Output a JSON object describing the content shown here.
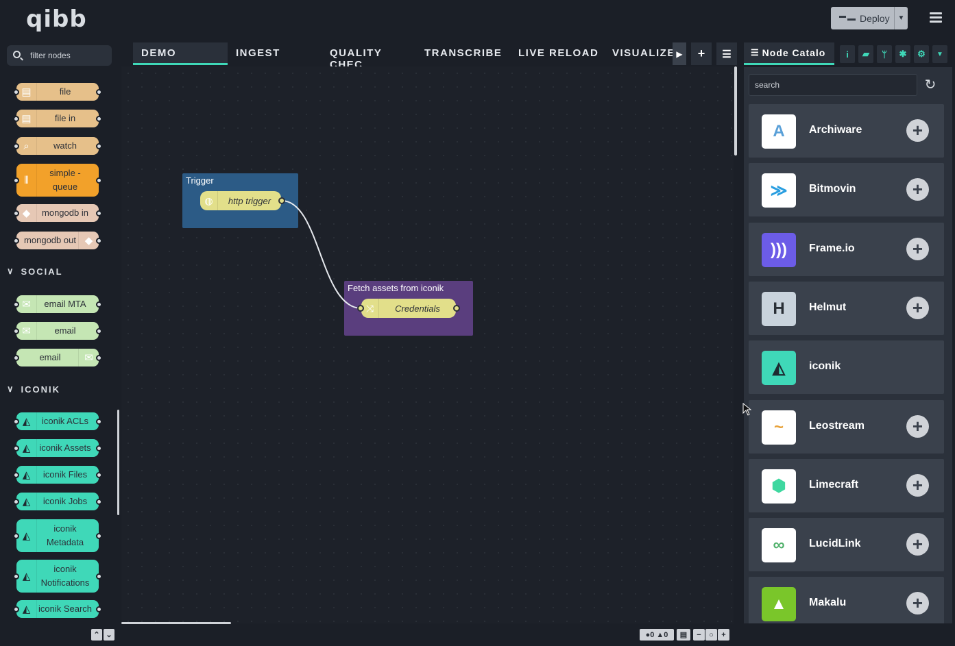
{
  "app": {
    "logo": "qibb"
  },
  "header": {
    "deploy_label": "Deploy",
    "menu_icon": "hamburger-icon"
  },
  "palette": {
    "filter_placeholder": "filter nodes",
    "storage_nodes": [
      {
        "label": "file",
        "color": "#e6c08a",
        "icon": "file-icon"
      },
      {
        "label": "file in",
        "color": "#e6c08a",
        "icon": "file-icon"
      },
      {
        "label": "watch",
        "color": "#e6c08a",
        "icon": "watch-icon"
      },
      {
        "label": "simple -\nqueue",
        "color": "#f2a12a",
        "icon": "queue-icon"
      },
      {
        "label": "mongodb in",
        "color": "#e6c8b5",
        "icon": "mongodb-icon"
      },
      {
        "label": "mongodb out",
        "color": "#e6c8b5",
        "icon": "mongodb-icon"
      }
    ],
    "social_header": "SOCIAL",
    "social_nodes": [
      {
        "label": "email MTA",
        "color": "#c5e6b4",
        "icon": "envelope-icon"
      },
      {
        "label": "email",
        "color": "#c5e6b4",
        "icon": "envelope-icon"
      },
      {
        "label": "email",
        "color": "#c5e6b4",
        "icon": "envelope-icon"
      }
    ],
    "iconik_header": "ICONIK",
    "iconik_nodes": [
      {
        "label": "iconik ACLs",
        "color": "#3fd8b8"
      },
      {
        "label": "iconik Assets",
        "color": "#3fd8b8"
      },
      {
        "label": "iconik Files",
        "color": "#3fd8b8"
      },
      {
        "label": "iconik Jobs",
        "color": "#3fd8b8"
      },
      {
        "label": "iconik\nMetadata",
        "color": "#3fd8b8"
      },
      {
        "label": "iconik\nNotifications",
        "color": "#3fd8b8"
      },
      {
        "label": "iconik Search",
        "color": "#3fd8b8"
      }
    ]
  },
  "tabs": [
    "DEMO",
    "INGEST",
    "QUALITY CHEC",
    "TRANSCRIBE",
    "LIVE RELOAD",
    "VISUALIZE"
  ],
  "flow": {
    "groups": [
      {
        "label": "Trigger",
        "color": "#2c5b86"
      },
      {
        "label": "Fetch assets from iconik",
        "color": "#5a3e7e"
      }
    ],
    "nodes": [
      {
        "label": "http trigger",
        "icon": "globe-icon"
      },
      {
        "label": "Credentials",
        "icon": "shuffle-icon"
      }
    ]
  },
  "footer": {
    "errors": "0",
    "warnings": "0"
  },
  "sidebar": {
    "tab_label": "Node Catalo",
    "search_placeholder": "search",
    "catalog": [
      {
        "name": "Archiware",
        "logo_bg": "#ffffff",
        "logo_color": "#5aa0d8",
        "logo_text": "A",
        "addable": true
      },
      {
        "name": "Bitmovin",
        "logo_bg": "#ffffff",
        "logo_color": "#2a9ee0",
        "logo_text": "≫",
        "addable": true
      },
      {
        "name": "Frame.io",
        "logo_bg": "#6c5ce7",
        "logo_color": "#ffffff",
        "logo_text": ")))",
        "addable": true
      },
      {
        "name": "Helmut",
        "logo_bg": "#c9d3dc",
        "logo_color": "#2a2f36",
        "logo_text": "H",
        "addable": true
      },
      {
        "name": "iconik",
        "logo_bg": "#3fd8b8",
        "logo_color": "#1e2a30",
        "logo_text": "◭",
        "addable": false
      },
      {
        "name": "Leostream",
        "logo_bg": "#ffffff",
        "logo_color": "#e8a23a",
        "logo_text": "~",
        "addable": true
      },
      {
        "name": "Limecraft",
        "logo_bg": "#ffffff",
        "logo_color": "#3fd8a0",
        "logo_text": "⬢",
        "addable": true
      },
      {
        "name": "LucidLink",
        "logo_bg": "#ffffff",
        "logo_color": "#4fb06a",
        "logo_text": "∞",
        "addable": true
      },
      {
        "name": "Makalu",
        "logo_bg": "#7ac62a",
        "logo_color": "#ffffff",
        "logo_text": "▲",
        "addable": true
      }
    ]
  }
}
